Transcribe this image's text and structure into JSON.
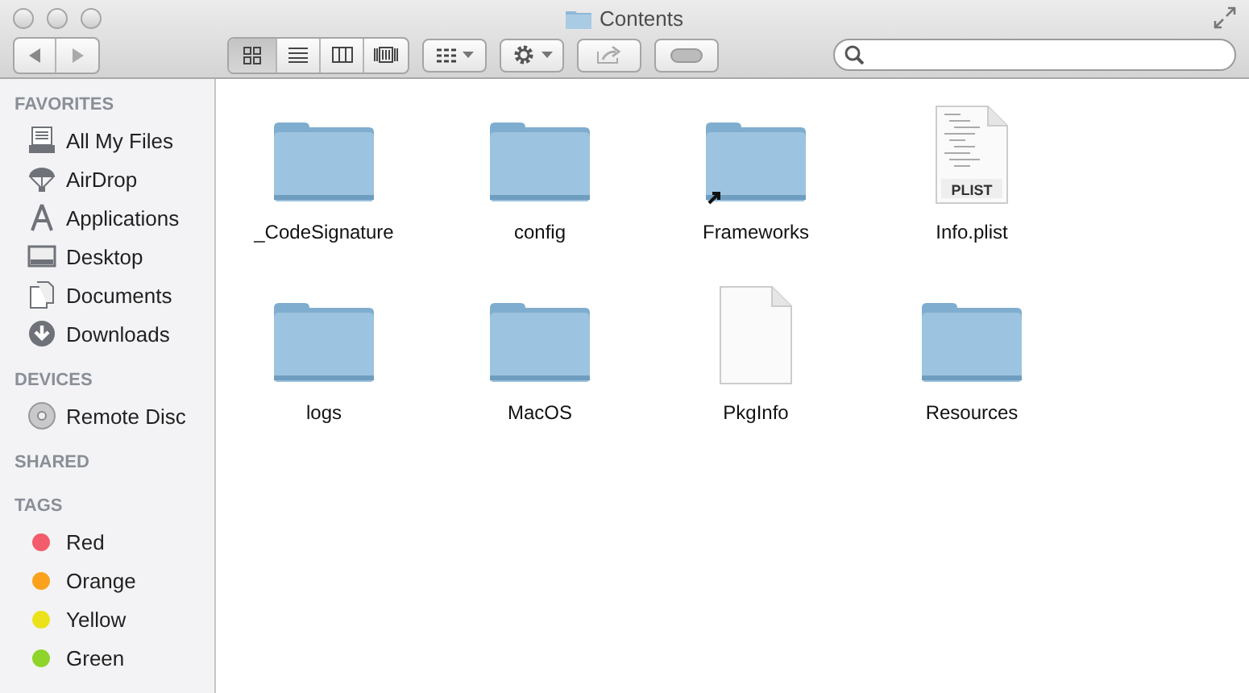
{
  "window": {
    "title": "Contents"
  },
  "toolbar": {
    "view_buttons": [
      {
        "kind": "icons",
        "selected": true
      },
      {
        "kind": "list",
        "selected": false
      },
      {
        "kind": "columns",
        "selected": false
      },
      {
        "kind": "coverflow",
        "selected": false
      }
    ]
  },
  "sidebar": {
    "sections": [
      {
        "title": "FAVORITES",
        "items": [
          {
            "label": "All My Files",
            "kind": "files"
          },
          {
            "label": "AirDrop",
            "kind": "airdrop"
          },
          {
            "label": "Applications",
            "kind": "apps"
          },
          {
            "label": "Desktop",
            "kind": "desktop"
          },
          {
            "label": "Documents",
            "kind": "documents"
          },
          {
            "label": "Downloads",
            "kind": "downloads"
          }
        ]
      },
      {
        "title": "DEVICES",
        "items": [
          {
            "label": "Remote Disc",
            "kind": "disc"
          }
        ]
      },
      {
        "title": "SHARED"
      },
      {
        "title": "TAGS",
        "items": [
          {
            "label": "Red",
            "kind": "tag",
            "color": "#f25c6b"
          },
          {
            "label": "Orange",
            "kind": "tag",
            "color": "#fba21d"
          },
          {
            "label": "Yellow",
            "kind": "tag",
            "color": "#ece21a"
          },
          {
            "label": "Green",
            "kind": "tag",
            "color": "#8ed42a"
          }
        ]
      }
    ]
  },
  "files": [
    {
      "name": "_CodeSignature",
      "kind": "folder"
    },
    {
      "name": "config",
      "kind": "folder"
    },
    {
      "name": "Frameworks",
      "kind": "folder",
      "alias": true
    },
    {
      "name": "Info.plist",
      "kind": "plist",
      "badge": "PLIST"
    },
    {
      "name": "logs",
      "kind": "folder"
    },
    {
      "name": "MacOS",
      "kind": "folder"
    },
    {
      "name": "PkgInfo",
      "kind": "document"
    },
    {
      "name": "Resources",
      "kind": "folder"
    }
  ]
}
